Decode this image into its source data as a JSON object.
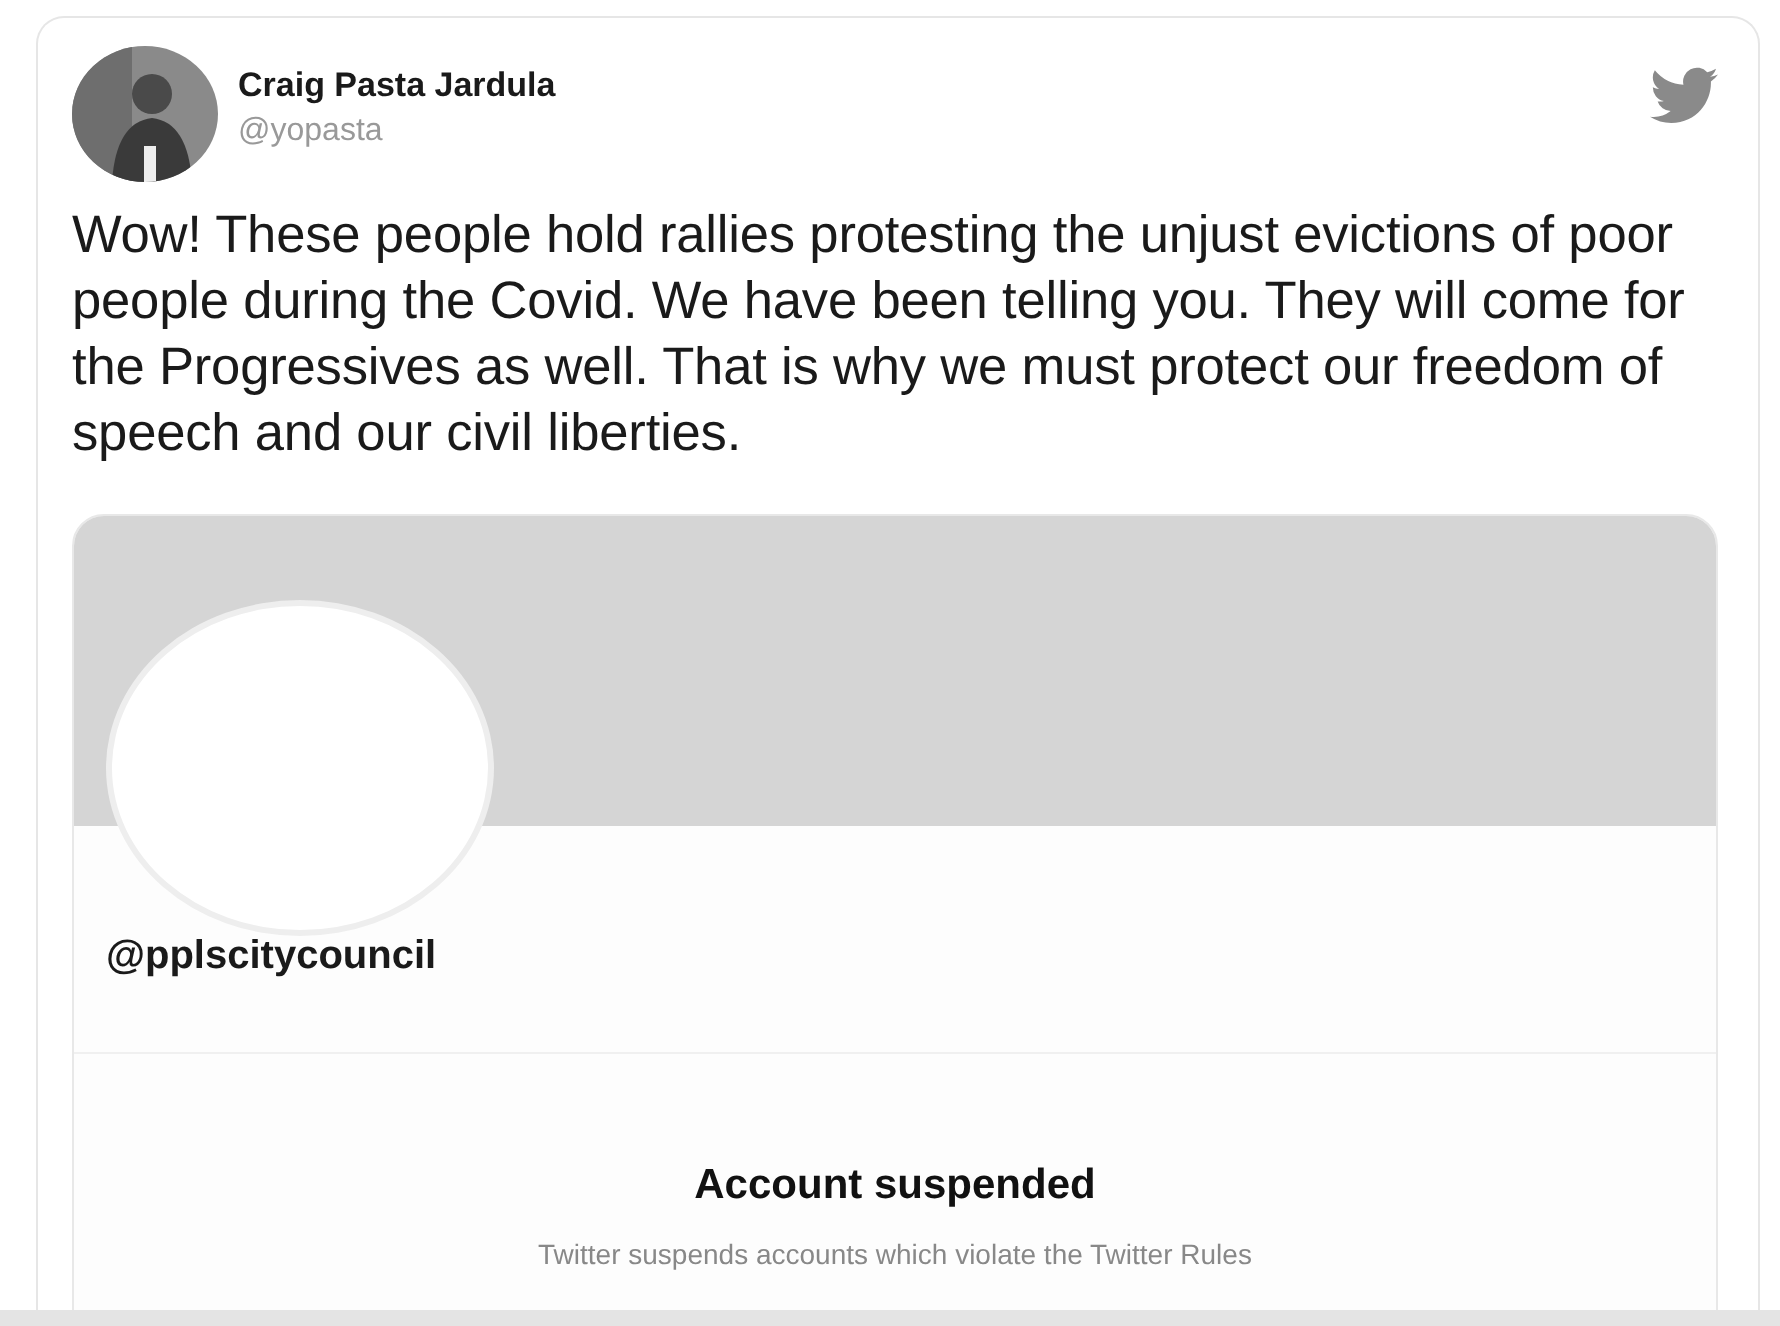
{
  "tweet": {
    "author": {
      "name": "Craig Pasta Jardula",
      "handle": "@yopasta"
    },
    "text": "Wow! These people hold rallies protesting the unjust evictions of poor people during the Covid. We have been telling you. They will come for the Progressives as well. That is why we must protect our freedom of speech and our civil liberties.",
    "embedded_profile": {
      "handle": "@pplscitycouncil",
      "suspended": true,
      "notice_title": "Account suspended",
      "notice_text": "Twitter suspends accounts which violate the Twitter Rules"
    }
  }
}
